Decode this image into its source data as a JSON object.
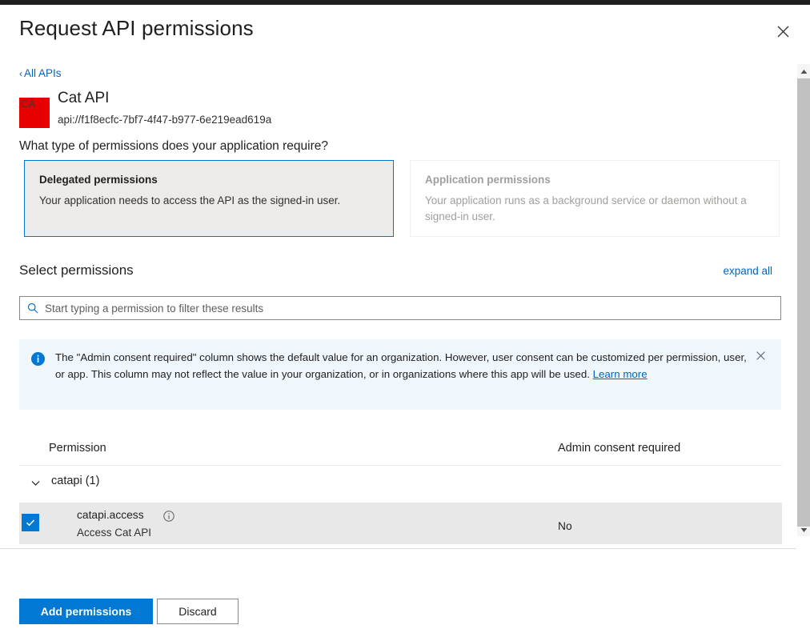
{
  "header": {
    "title": "Request API permissions",
    "close_icon": "close-icon"
  },
  "breadcrumb": {
    "chevron": "‹",
    "label": "All APIs"
  },
  "api": {
    "logo_initials": "CA",
    "logo_color": "#e60000",
    "name": "Cat API",
    "identifier_uri": "api://f1f8ecfc-7bf7-4f47-b977-6e219ead619a"
  },
  "permission_type": {
    "question": "What type of permissions does your application require?",
    "options": [
      {
        "title": "Delegated permissions",
        "description": "Your application needs to access the API as the signed-in user.",
        "selected": true,
        "disabled": false
      },
      {
        "title": "Application permissions",
        "description": "Your application runs as a background service or daemon without a signed-in user.",
        "selected": false,
        "disabled": true
      }
    ]
  },
  "select_permissions": {
    "heading": "Select permissions",
    "expand_all_label": "expand all",
    "search": {
      "icon": "search-icon",
      "placeholder": "Start typing a permission to filter these results",
      "value": ""
    }
  },
  "info_banner": {
    "icon": "info-icon",
    "text": "The \"Admin consent required\" column shows the default value for an organization. However, user consent can be customized per permission, user, or app. This column may not reflect the value in your organization, or in organizations where this app will be used.",
    "link_label": "Learn more",
    "close_icon": "close-icon"
  },
  "table": {
    "columns": [
      "Permission",
      "Admin consent required"
    ],
    "groups": [
      {
        "chevron": "chevron-down-icon",
        "label": "catapi (1)",
        "rows": [
          {
            "checked": true,
            "name": "catapi.access",
            "info_icon": "info-circle-icon",
            "description": "Access Cat API",
            "admin_consent_required": "No"
          }
        ]
      }
    ]
  },
  "scrollbar": {
    "up_arrow": "caret-up-icon",
    "down_arrow": "caret-down-icon"
  },
  "footer": {
    "primary_label": "Add permissions",
    "secondary_label": "Discard"
  },
  "colors": {
    "accent": "#0078d4",
    "link": "#0064c1",
    "banner_bg": "#eff6fc",
    "selected_card_bg": "#edebe9",
    "row_bg": "#e8e8e8"
  }
}
